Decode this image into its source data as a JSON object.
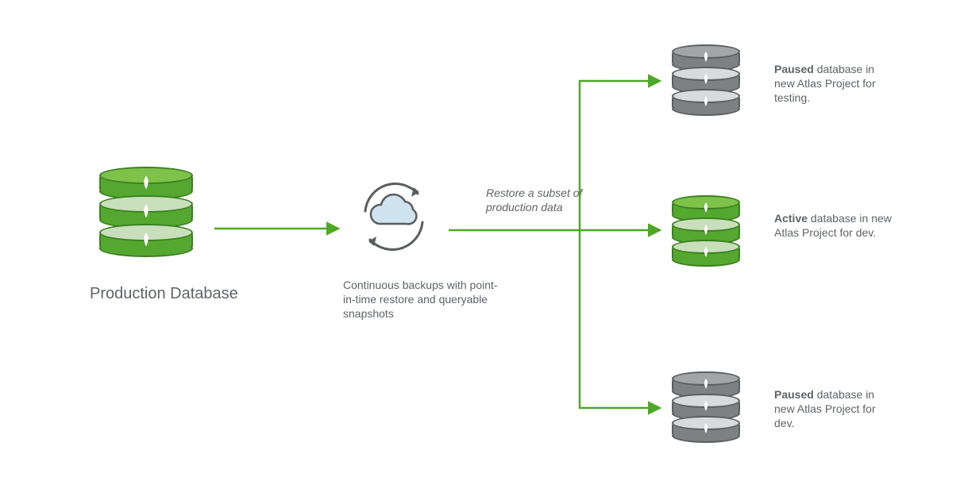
{
  "colors": {
    "arrow": "#4fa728",
    "text": "#5f6368",
    "db_green_main": "#54a82f",
    "db_green_top": "#7ec24a",
    "db_green_border": "#3a7f1f",
    "db_grey_main": "#7e8183",
    "db_grey_top": "#a3a6a8",
    "db_grey_border": "#5b5e60",
    "cloud_fill": "#cfe3ef",
    "cloud_stroke": "#5a5d60"
  },
  "labels": {
    "production_db": "Production Database",
    "backup_caption": "Continuous backups with point-in-time restore and queryable snapshots",
    "restore_note": "Restore a subset of production data"
  },
  "targets": [
    {
      "status": "Paused",
      "status_bold": "Paused",
      "rest": " database in new Atlas Project for testing.",
      "state": "paused"
    },
    {
      "status": "Active",
      "status_bold": "Active",
      "rest": " database in new Atlas Project for dev.",
      "state": "active"
    },
    {
      "status": "Paused",
      "status_bold": "Paused",
      "rest": " database in new Atlas Project for dev.",
      "state": "paused"
    }
  ]
}
